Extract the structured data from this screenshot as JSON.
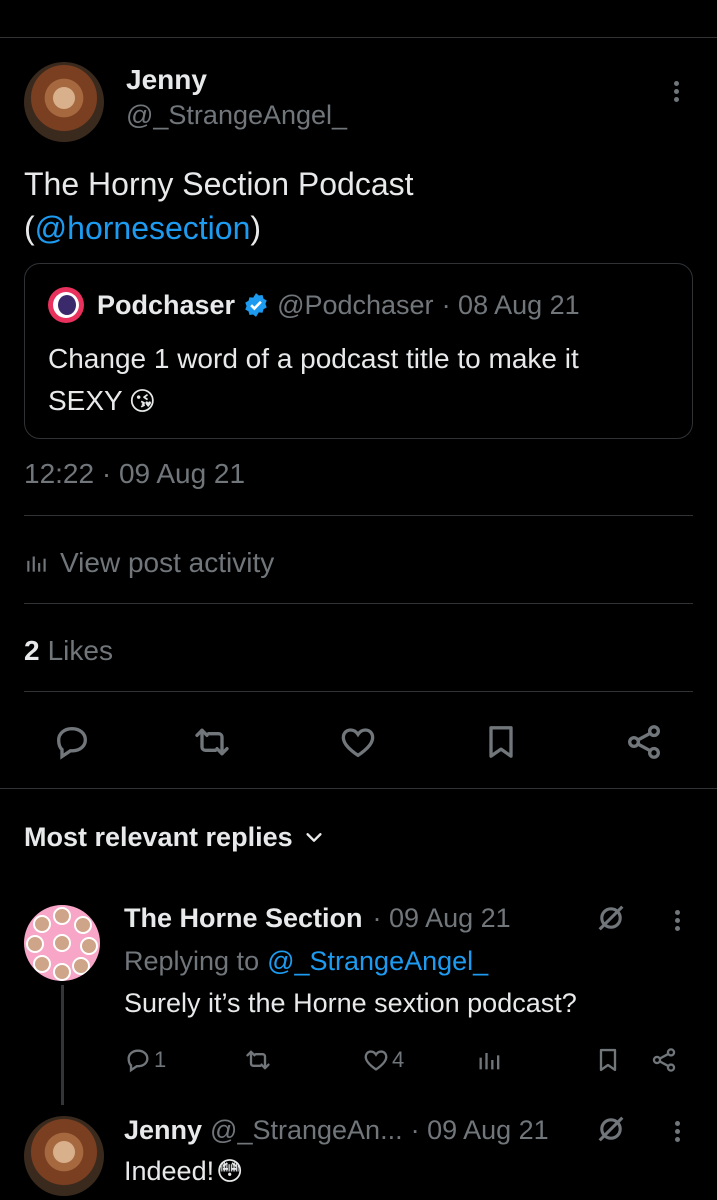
{
  "post": {
    "author_name": "Jenny",
    "author_handle": "@_StrangeAngel_",
    "text_line1": "The Horny Section Podcast",
    "text_open": "(",
    "text_mention": "@hornesection",
    "text_close": ")",
    "timestamp": "12:22 · 09 Aug 21",
    "activity_label": "View post activity",
    "likes_count": "2",
    "likes_label": "Likes"
  },
  "quote": {
    "name": "Podchaser",
    "handle": "@Podchaser",
    "date": "· 08 Aug 21",
    "text_line1": "Change 1 word of a podcast title to make it",
    "text_line2": "SEXY",
    "emoji": "😘"
  },
  "replies_header": "Most relevant replies",
  "replies": [
    {
      "name": "The Horne Section",
      "date": "· 09 Aug 21",
      "replying_prefix": "Replying to",
      "replying_handle": "@_StrangeAngel_",
      "text": "Surely it’s the Horne sextion podcast?",
      "reply_count": "1",
      "like_count": "4"
    },
    {
      "name": "Jenny",
      "handle": "@_StrangeAn...",
      "date": "· 09 Aug 21",
      "text": "Indeed!",
      "emoji": "😳"
    }
  ],
  "colors": {
    "accent": "#1d9bf0",
    "muted": "#71767b",
    "text": "#e7e9ea",
    "divider": "#2f3336",
    "background": "#000000"
  }
}
